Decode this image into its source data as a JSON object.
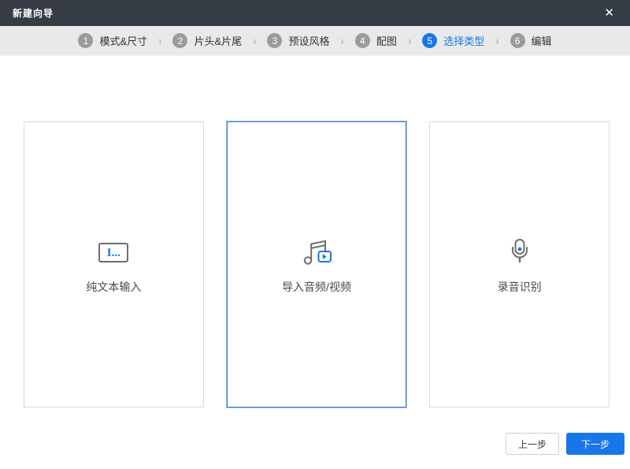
{
  "window": {
    "title": "新建向导",
    "close_glyph": "✕"
  },
  "steps": {
    "separator": "›",
    "items": [
      {
        "num": "1",
        "label": "模式&尺寸",
        "active": false
      },
      {
        "num": "2",
        "label": "片头&片尾",
        "active": false
      },
      {
        "num": "3",
        "label": "预设风格",
        "active": false
      },
      {
        "num": "4",
        "label": "配图",
        "active": false
      },
      {
        "num": "5",
        "label": "选择类型",
        "active": true
      },
      {
        "num": "6",
        "label": "编辑",
        "active": false
      }
    ]
  },
  "cards": [
    {
      "label": "纯文本输入",
      "icon": "text-input-icon",
      "icon_text": "I...",
      "selected": false
    },
    {
      "label": "导入音频/视频",
      "icon": "audio-video-icon",
      "selected": true
    },
    {
      "label": "录音识别",
      "icon": "microphone-icon",
      "selected": false
    }
  ],
  "footer": {
    "prev_label": "上一步",
    "next_label": "下一步"
  },
  "colors": {
    "accent": "#1877e8",
    "titlebar": "#363c46",
    "stepbar_bg": "#e9e9e9",
    "inactive_circle": "#9b9b9b",
    "card_border": "#d9d9d9",
    "selected_border": "#2577d4",
    "icon_gray": "#6e6e6e"
  }
}
